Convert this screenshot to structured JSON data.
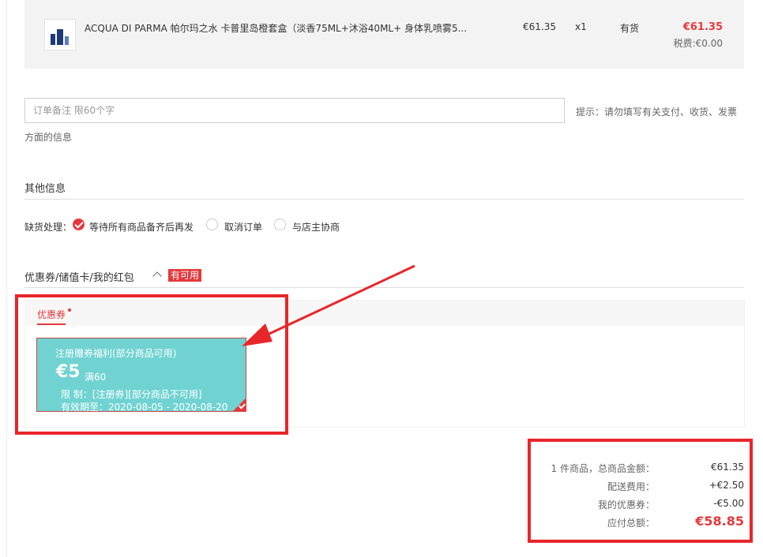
{
  "product": {
    "name": "ACQUA DI PARMA 帕尔玛之水 卡普里岛橙套盒（淡香75ML+沐浴40ML+ 身体乳喷雾5...",
    "price": "€61.35",
    "qty": "x1",
    "stock": "有货",
    "total": "€61.35",
    "tax": "税费:€0.00"
  },
  "remark": {
    "placeholder": "订单备注 限60个字",
    "hint_line1": "提示：请勿填写有关支付、收货、发票",
    "hint_line2": "方面的信息"
  },
  "other_info": {
    "title": "其他信息",
    "shortage_label": "缺货处理：",
    "options": [
      {
        "label": "等待所有商品备齐后再发",
        "checked": true
      },
      {
        "label": "取消订单",
        "checked": false
      },
      {
        "label": "与店主协商",
        "checked": false
      }
    ]
  },
  "coupons": {
    "title": "优惠券/储值卡/我的红包",
    "available_badge": "有可用",
    "tab": "优惠券",
    "card": {
      "title": "注册赠券福利(部分商品可用)",
      "amount": "€5",
      "condition": "满60",
      "limit": "限 制：[注册券][部分商品不可用]",
      "valid": "有效期至：2020-08-05 - 2020-08-20",
      "selected": true
    }
  },
  "summary": {
    "items_label": "1 件商品，总商品金额：",
    "items_value": "€61.35",
    "shipping_label": "配送费用：",
    "shipping_value": "+€2.50",
    "coupon_label": "我的优惠券：",
    "coupon_value": "-€5.00",
    "total_label": "应付总额：",
    "total_value": "€58.85"
  },
  "colors": {
    "accent": "#e4393c",
    "coupon_card": "#70d3d2",
    "annotation": "#e8262a"
  }
}
